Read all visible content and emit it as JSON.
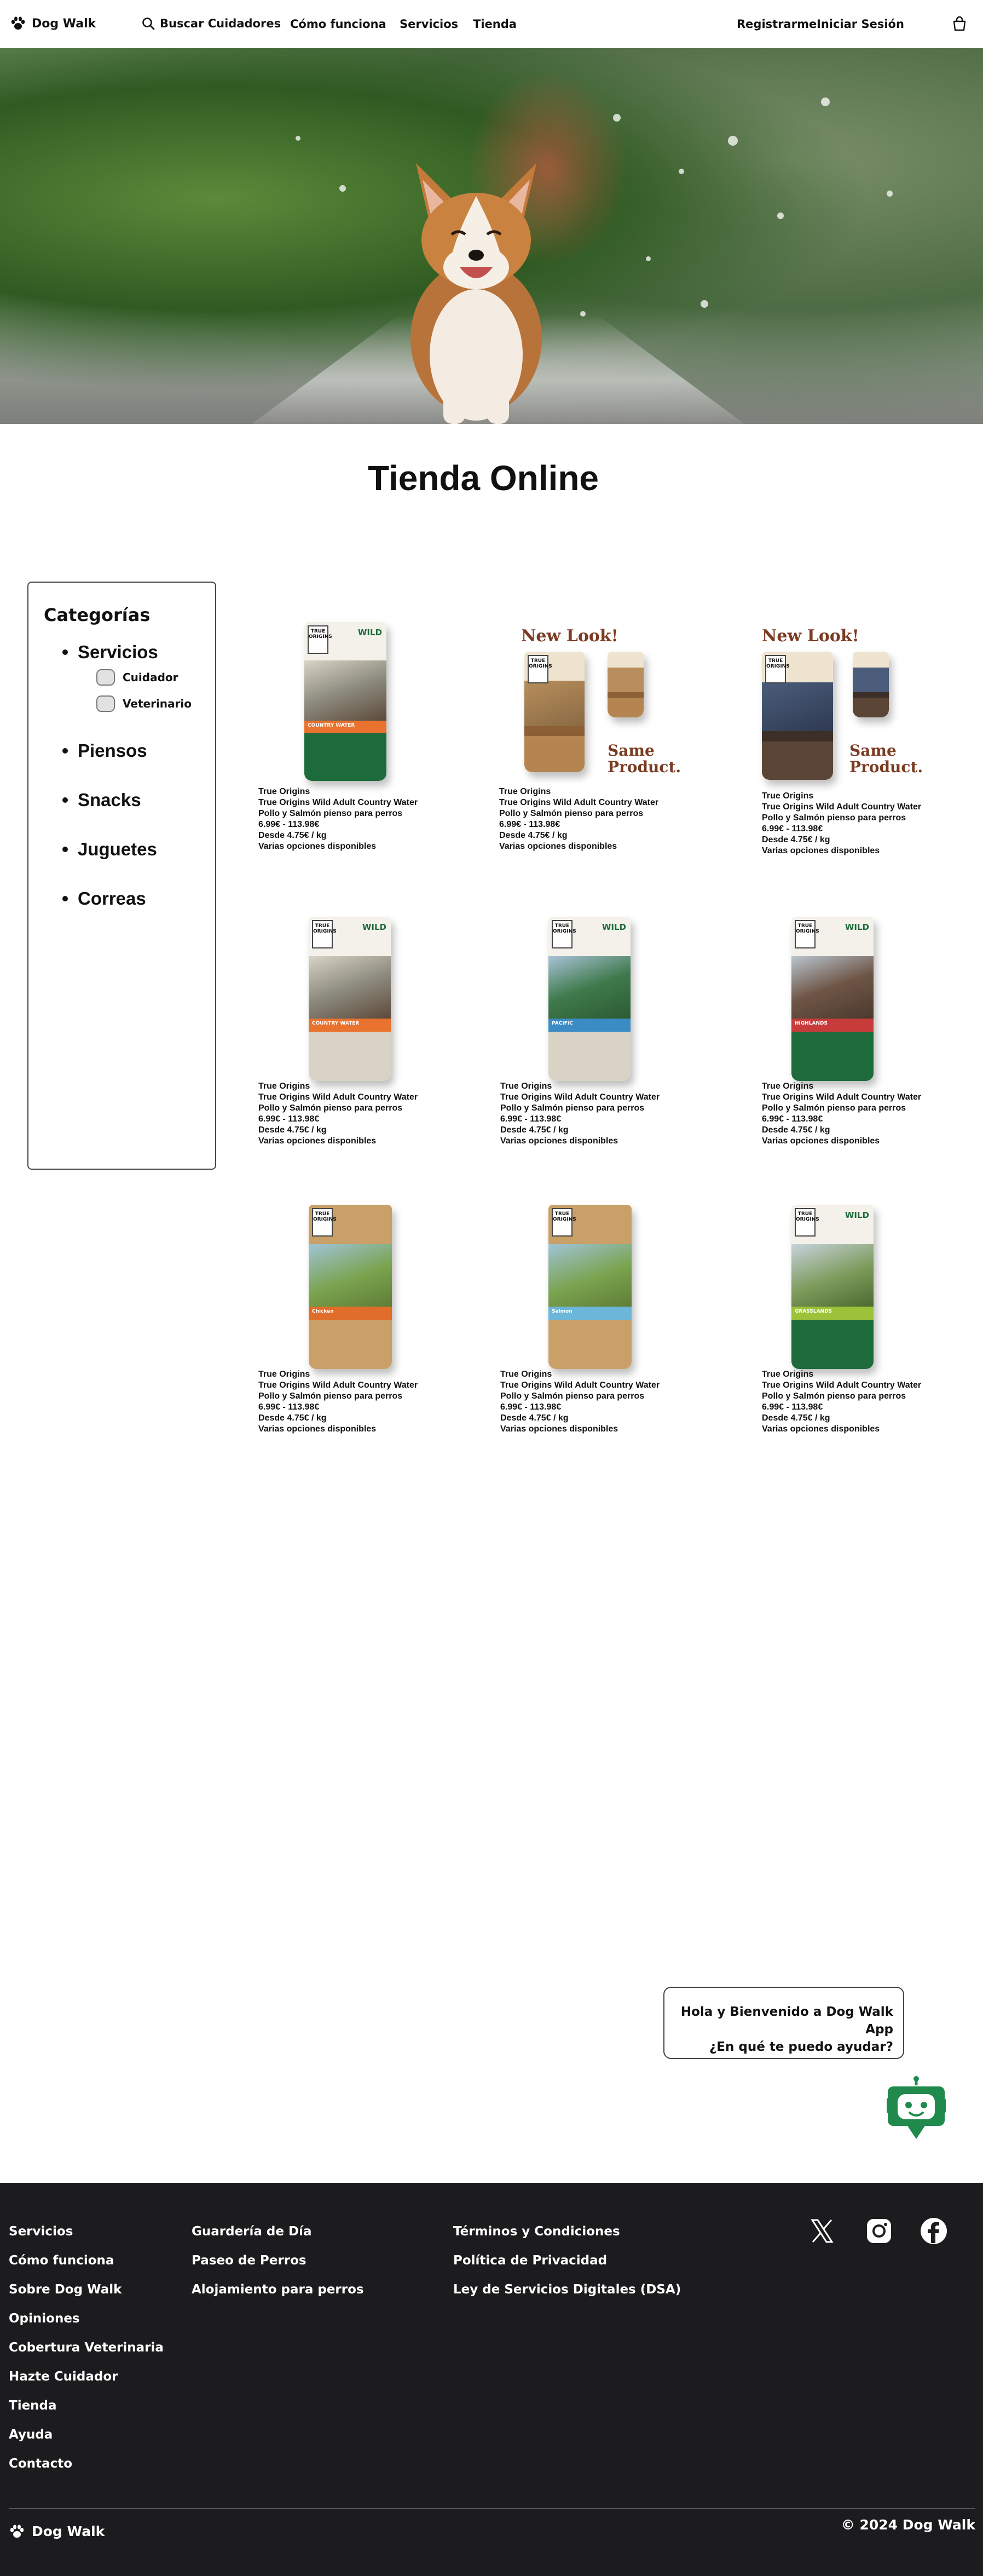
{
  "nav": {
    "brand": "Dog Walk",
    "search_label": "Buscar Cuidadores",
    "how_label": "Cómo funciona",
    "services_label": "Servicios",
    "shop_label": "Tienda",
    "register_label": "Registrarme",
    "login_label": "Iniciar Sesión"
  },
  "page": {
    "title": "Tienda Online"
  },
  "sidebar": {
    "heading": "Categorías",
    "categories": [
      {
        "label": "Servicios",
        "subcategories": [
          "Cuidador",
          "Veterinario"
        ]
      },
      {
        "label": "Piensos"
      },
      {
        "label": "Snacks"
      },
      {
        "label": "Juguetes"
      },
      {
        "label": "Correas"
      }
    ]
  },
  "products": [
    {
      "brand": "True Origins",
      "name": "True Origins Wild Adult Country Water",
      "desc": "Pollo y Salmón pienso para perros",
      "price": "6.99€ - 113.98€",
      "unit": "Desde 4.75€ / kg",
      "options": "Varias opciones disponibles"
    },
    {
      "brand": "True Origins",
      "name": "True Origins Wild Adult Country Water",
      "desc": "Pollo y Salmón pienso para perros",
      "price": "6.99€ - 113.98€",
      "unit": "Desde 4.75€ / kg",
      "options": "Varias opciones disponibles",
      "badge_top": "New Look!",
      "badge_bottom": "Same Product."
    },
    {
      "brand": "True Origins",
      "name": "True Origins Wild Adult Country Water",
      "desc": "Pollo y Salmón pienso para perros",
      "price": "6.99€ - 113.98€",
      "unit": "Desde 4.75€ / kg",
      "options": "Varias opciones disponibles",
      "badge_top": "New Look!",
      "badge_bottom": "Same Product."
    },
    {
      "brand": "True Origins",
      "name": "True Origins Wild Adult Country Water",
      "desc": "Pollo y Salmón pienso para perros",
      "price": "6.99€ - 113.98€",
      "unit": "Desde 4.75€ / kg",
      "options": "Varias opciones disponibles"
    },
    {
      "brand": "True Origins",
      "name": "True Origins Wild Adult Country Water",
      "desc": "Pollo y Salmón pienso para perros",
      "price": "6.99€ - 113.98€",
      "unit": "Desde 4.75€ / kg",
      "options": "Varias opciones disponibles"
    },
    {
      "brand": "True Origins",
      "name": "True Origins Wild Adult Country Water",
      "desc": "Pollo y Salmón pienso para perros",
      "price": "6.99€ - 113.98€",
      "unit": "Desde 4.75€ / kg",
      "options": "Varias opciones disponibles"
    },
    {
      "brand": "True Origins",
      "name": "True Origins Wild Adult Country Water",
      "desc": "Pollo y Salmón pienso para perros",
      "price": "6.99€ - 113.98€",
      "unit": "Desde 4.75€ / kg",
      "options": "Varias opciones disponibles"
    },
    {
      "brand": "True Origins",
      "name": "True Origins Wild Adult Country Water",
      "desc": "Pollo y Salmón pienso para perros",
      "price": "6.99€ - 113.98€",
      "unit": "Desde 4.75€ / kg",
      "options": "Varias opciones disponibles"
    },
    {
      "brand": "True Origins",
      "name": "True Origins Wild Adult Country Water",
      "desc": "Pollo y Salmón pienso para perros",
      "price": "6.99€ - 113.98€",
      "unit": "Desde 4.75€ / kg",
      "options": "Varias opciones disponibles"
    }
  ],
  "packaging": {
    "logo_text": "TRUE ORIGINS",
    "wild": "WILD",
    "bands": [
      "COUNTRY WATER",
      "COUNTRY WATER",
      "PACIFIC",
      "HIGHLANDS",
      "Chicken",
      "Salmon",
      "GRASSLANDS"
    ]
  },
  "colors": {
    "accent_green": "#1f8a4c",
    "footer_bg": "#1c1c1e",
    "bag_green": "#1d6b3a",
    "bag_tan": "#c8a068"
  },
  "icons": {
    "search": "search-icon",
    "cart": "shopping-bag-icon",
    "robot": "chatbot-icon",
    "paw": "paw-icon"
  },
  "chat": {
    "line1": "Hola y Bienvenido a Dog Walk App",
    "line2": "¿En qué te puedo ayudar?"
  },
  "footer": {
    "col1": [
      "Servicios",
      "Cómo funciona",
      "Sobre Dog Walk",
      "Opiniones",
      "Cobertura Veterinaria",
      "Hazte Cuidador",
      "Tienda",
      "Ayuda",
      "Contacto"
    ],
    "col2": [
      "Guardería de Día",
      "Paseo de Perros",
      "Alojamiento para perros"
    ],
    "col3": [
      "Términos y Condiciones",
      "Política de Privacidad",
      "Ley de Servicios Digitales (DSA)"
    ],
    "brand": "Dog Walk",
    "copyright": "© 2024 Dog Walk"
  }
}
